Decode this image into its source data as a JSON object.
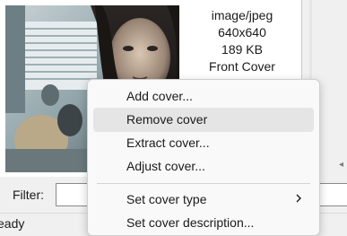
{
  "cover": {
    "mime_type": "image/jpeg",
    "dimensions": "640x640",
    "size": "189 KB",
    "type": "Front Cover"
  },
  "filter": {
    "label": "Filter:",
    "value": ""
  },
  "status": {
    "text": "eady"
  },
  "context_menu": {
    "items": [
      {
        "label": "Add cover..."
      },
      {
        "label": "Remove cover",
        "highlighted": true
      },
      {
        "label": "Extract cover..."
      },
      {
        "label": "Adjust cover..."
      },
      {
        "label": "Set cover type",
        "has_submenu": true
      },
      {
        "label": "Set cover description..."
      }
    ]
  },
  "icons": {
    "submenu": "chevron-right-icon",
    "scroll": "scroll-arrow-icon"
  }
}
